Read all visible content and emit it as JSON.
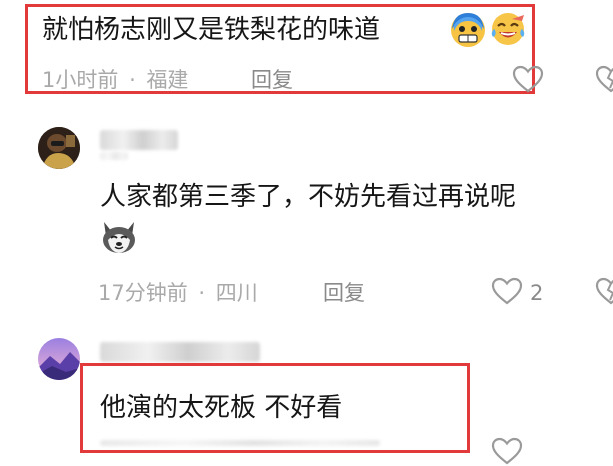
{
  "comments": [
    {
      "text": "就怕杨志刚又是铁梨花的味道",
      "time": "1小时前",
      "separator": "·",
      "location": "福建",
      "reply_label": "回复",
      "emoji_icons": [
        "grimacing-cold-face-icon",
        "laughing-tears-face-icon"
      ]
    },
    {
      "text": "人家都第三季了，不妨先看过再说呢",
      "time": "17分钟前",
      "separator": "·",
      "location": "四川",
      "reply_label": "回复",
      "like_count": "2",
      "sticker_icon": "husky-dog-sticker-icon"
    },
    {
      "text": "他演的太死板  不好看"
    }
  ],
  "colors": {
    "highlight_box": "#e23a3a",
    "meta_text": "#a9a9a9",
    "body_text": "#161616"
  }
}
